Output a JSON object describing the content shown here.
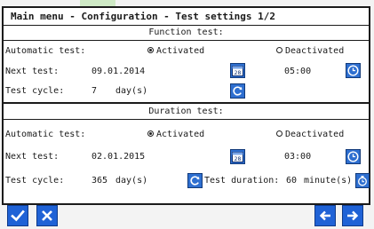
{
  "title": "Main menu - Configuration - Test settings 1/2",
  "function_test": {
    "heading": "Function test:",
    "automatic_label": "Automatic test:",
    "activated_label": "Activated",
    "deactivated_label": "Deactivated",
    "selected": "Activated",
    "next_label": "Next test:",
    "next_date": "09.01.2014",
    "next_time": "05:00",
    "cycle_label": "Test cycle:",
    "cycle_value": "7",
    "cycle_unit": "day(s)"
  },
  "duration_test": {
    "heading": "Duration test:",
    "automatic_label": "Automatic test:",
    "activated_label": "Activated",
    "deactivated_label": "Deactivated",
    "selected": "Activated",
    "next_label": "Next test:",
    "next_date": "02.01.2015",
    "next_time": "03:00",
    "cycle_label": "Test cycle:",
    "cycle_value": "365",
    "cycle_unit": "day(s)",
    "duration_label": "Test duration:",
    "duration_value": "60",
    "duration_unit": "minute(s)"
  },
  "calendar_icon_text": "28",
  "icons": {
    "calendar": "calendar-icon",
    "clock": "clock-icon",
    "refresh": "refresh-icon",
    "stopwatch": "stopwatch-icon",
    "confirm": "check-icon",
    "cancel": "close-icon",
    "back": "arrow-left-icon",
    "forward": "arrow-right-icon"
  },
  "colors": {
    "button_blue": "#2e6fd0",
    "nav_blue": "#1f62d6",
    "accent_green": "#9bd48a"
  }
}
